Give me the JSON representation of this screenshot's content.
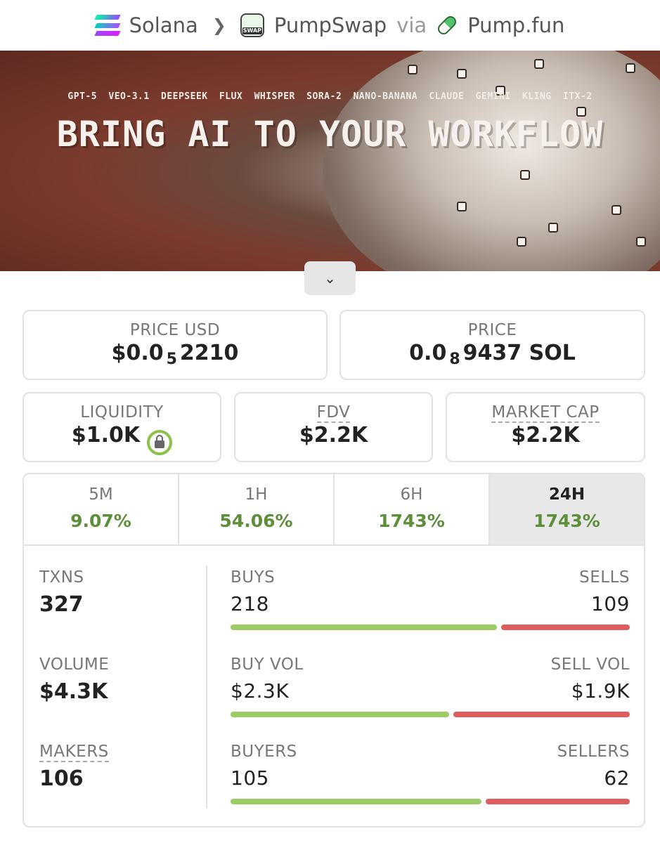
{
  "breadcrumb": {
    "chain": "Solana",
    "dex": "PumpSwap",
    "via": "via",
    "launchpad": "Pump.fun",
    "swap_icon_text": "SWAP"
  },
  "banner": {
    "tags": "GPT-5 VEO-3.1 DEEPSEEK FLUX WHISPER SORA-2 NANO-BANANA CLAUDE GEMINI KLING ITX-2",
    "headline": "BRING AI TO YOUR WORKFLOW"
  },
  "price_usd": {
    "label": "PRICE USD",
    "prefix": "$0.0",
    "sub": "5",
    "digits": "2210"
  },
  "price": {
    "label": "PRICE",
    "prefix": "0.0",
    "sub": "8",
    "digits": "9437 SOL"
  },
  "liquidity": {
    "label": "LIQUIDITY",
    "value": "$1.0K"
  },
  "fdv": {
    "label": "FDV",
    "value": "$2.2K"
  },
  "market_cap": {
    "label": "MARKET CAP",
    "value": "$2.2K"
  },
  "tabs": [
    {
      "label": "5M",
      "value": "9.07%"
    },
    {
      "label": "1H",
      "value": "54.06%"
    },
    {
      "label": "6H",
      "value": "1743%"
    },
    {
      "label": "24H",
      "value": "1743%"
    }
  ],
  "active_tab": "24H",
  "txns": {
    "label": "TXNS",
    "value": "327"
  },
  "volume": {
    "label": "VOLUME",
    "value": "$4.3K"
  },
  "makers": {
    "label": "MAKERS",
    "value": "106"
  },
  "buys_sells": {
    "left_label": "BUYS",
    "right_label": "SELLS",
    "left": "218",
    "right": "109",
    "buy_fraction": 0.667
  },
  "vol_split": {
    "left_label": "BUY VOL",
    "right_label": "SELL VOL",
    "left": "$2.3K",
    "right": "$1.9K",
    "buy_fraction": 0.548
  },
  "buyers_sellers": {
    "left_label": "BUYERS",
    "right_label": "SELLERS",
    "left": "105",
    "right": "62",
    "buy_fraction": 0.629
  },
  "colors": {
    "positive": "#5d8f3a",
    "buy_bar": "#9ccc65",
    "sell_bar": "#e05d5d"
  }
}
